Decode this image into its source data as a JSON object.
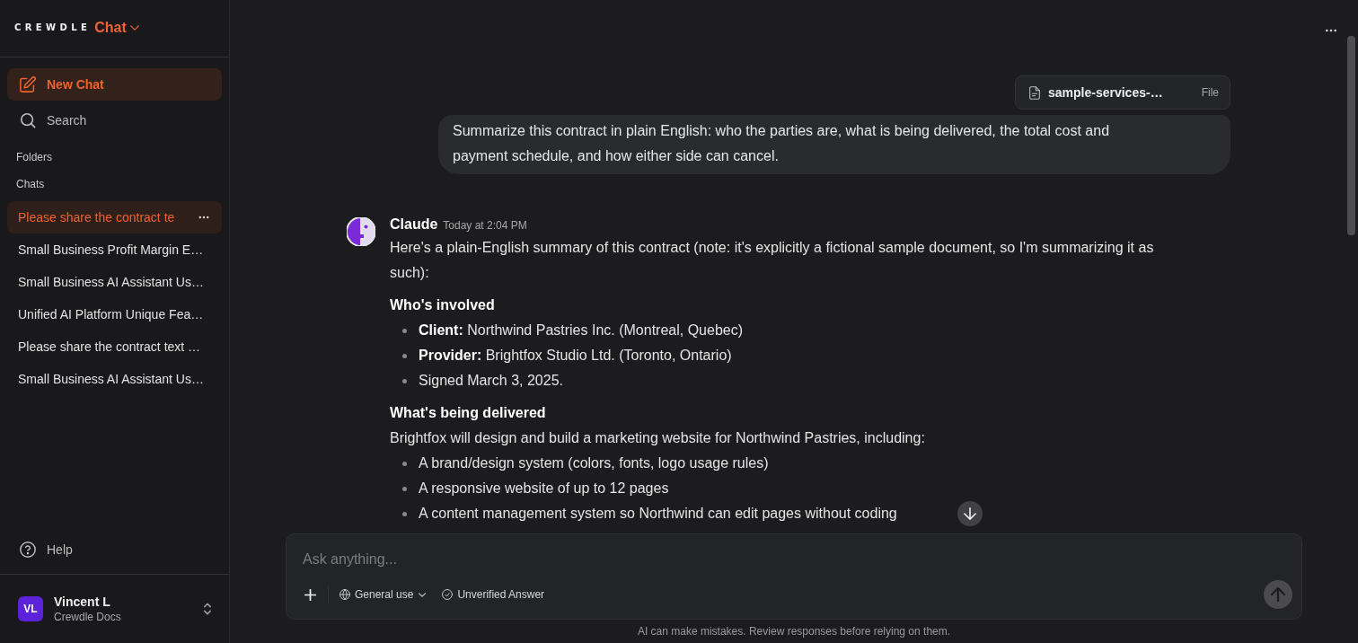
{
  "sidebar": {
    "brand": {
      "wordmark": "CREWDLE",
      "product": "Chat"
    },
    "actions": [
      {
        "kind": "new_chat",
        "label": "New Chat"
      },
      {
        "kind": "search",
        "label": "Search"
      }
    ],
    "folders_heading": "Folders",
    "chats_heading": "Chats",
    "chats": [
      {
        "title": "Please share the contract te",
        "selected": true
      },
      {
        "title": "Small Business Profit Margin E…",
        "selected": false
      },
      {
        "title": "Small Business AI Assistant Us…",
        "selected": false
      },
      {
        "title": "Unified AI Platform Unique Fea…",
        "selected": false
      },
      {
        "title": "Please share the contract text …",
        "selected": false
      },
      {
        "title": "Small Business AI Assistant Us…",
        "selected": false
      }
    ],
    "help": "Help",
    "user": {
      "initials": "VL",
      "name": "Vincent L",
      "workspace": "Crewdle Docs"
    }
  },
  "thread": {
    "attachment": {
      "name": "sample-services-…",
      "type": "File"
    },
    "user_message": "Summarize this contract in plain English: who the parties are, what is being delivered, the total cost and payment schedule, and how either side can cancel.",
    "reply": {
      "author": "Claude",
      "time": "Today at 2:04 PM",
      "blocks": [
        {
          "kind": "paragraph",
          "text": "Here's a plain-English summary of this contract (note: it's explicitly a fictional sample document, so I'm summarizing it as such):"
        },
        {
          "kind": "heading",
          "text": "Who's involved"
        },
        {
          "kind": "list",
          "items": [
            "**Client:** Northwind Pastries Inc. (Montreal, Quebec)",
            "**Provider:** Brightfox Studio Ltd. (Toronto, Ontario)",
            "Signed March 3, 2025."
          ]
        },
        {
          "kind": "heading",
          "text": "What's being delivered"
        },
        {
          "kind": "paragraph",
          "text": "Brightfox will design and build a marketing website for Northwind Pastries, including:"
        },
        {
          "kind": "list",
          "items": [
            "A brand/design system (colors, fonts, logo usage rules)",
            "A responsive website of up to 12 pages",
            "A content management system so Northwind can edit pages without coding"
          ]
        }
      ]
    }
  },
  "composer": {
    "placeholder": "Ask anything...",
    "mode": "General use",
    "verification": "Unverified Answer"
  },
  "disclaimer": "AI can make mistakes. Review responses before relying on them."
}
